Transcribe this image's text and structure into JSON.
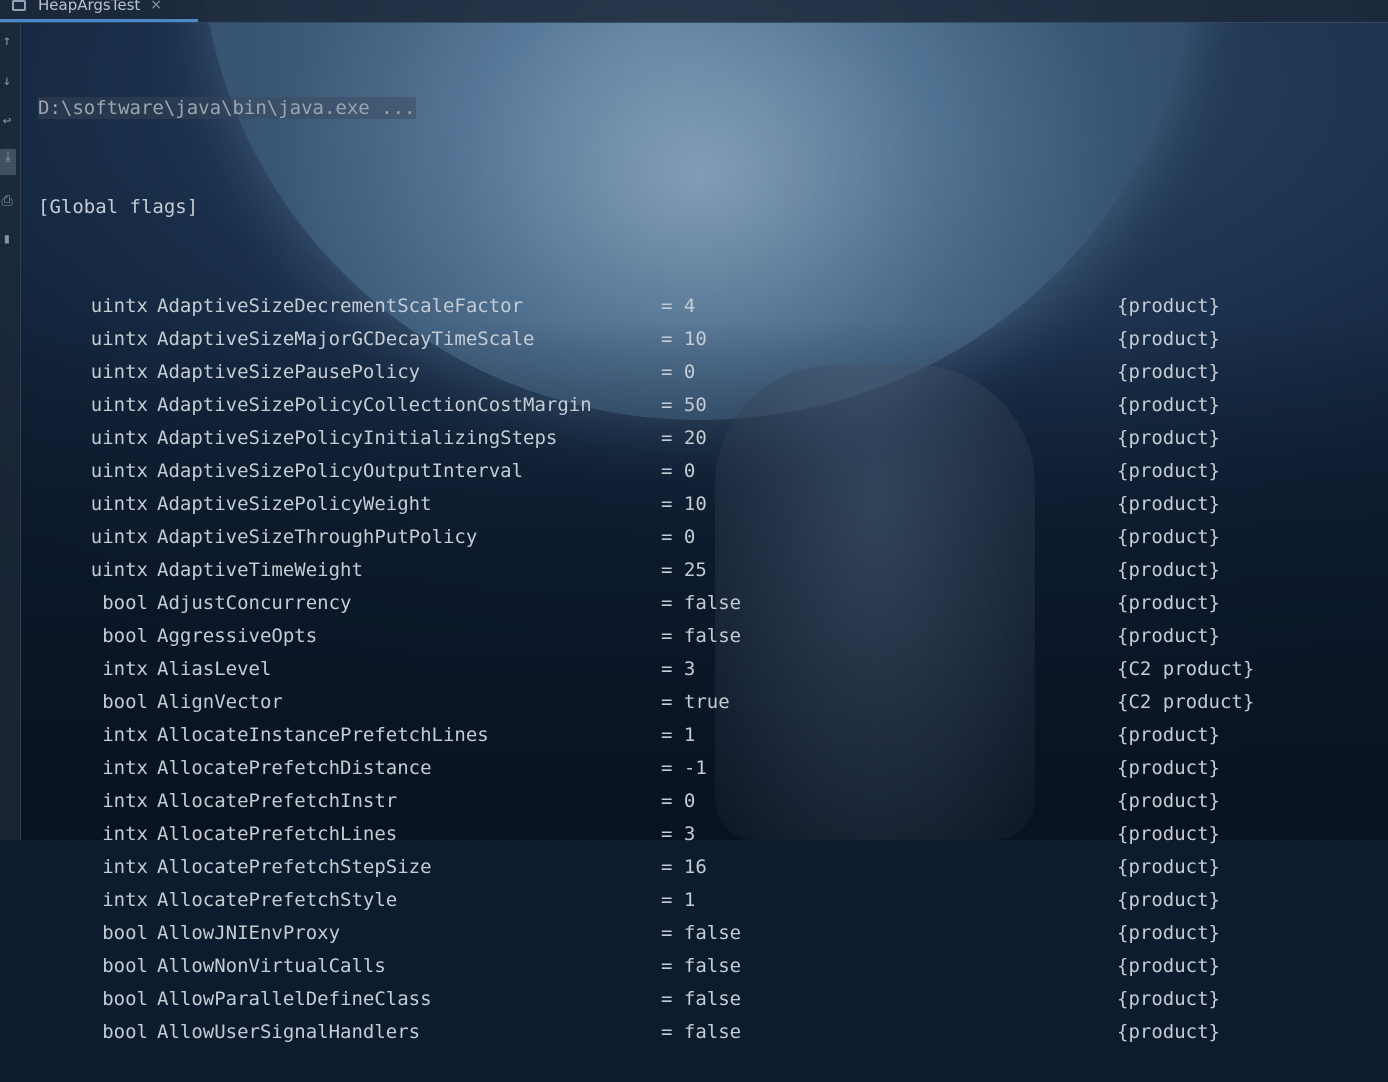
{
  "tab": {
    "title": "HeapArgsTest",
    "close_glyph": "×"
  },
  "gutter_icons": [
    "up-arrow-icon",
    "down-arrow-icon",
    "soft-wrap-icon",
    "scroll-to-end-icon",
    "print-icon",
    "trash-icon"
  ],
  "console": {
    "command": "D:\\software\\java\\bin\\java.exe ...",
    "section": "[Global flags]",
    "rows": [
      {
        "type": "uintx",
        "name": "AdaptiveSizeDecrementScaleFactor",
        "value": "= 4",
        "kind": "{product}"
      },
      {
        "type": "uintx",
        "name": "AdaptiveSizeMajorGCDecayTimeScale",
        "value": "= 10",
        "kind": "{product}"
      },
      {
        "type": "uintx",
        "name": "AdaptiveSizePausePolicy",
        "value": "= 0",
        "kind": "{product}"
      },
      {
        "type": "uintx",
        "name": "AdaptiveSizePolicyCollectionCostMargin",
        "value": "= 50",
        "kind": "{product}"
      },
      {
        "type": "uintx",
        "name": "AdaptiveSizePolicyInitializingSteps",
        "value": "= 20",
        "kind": "{product}"
      },
      {
        "type": "uintx",
        "name": "AdaptiveSizePolicyOutputInterval",
        "value": "= 0",
        "kind": "{product}"
      },
      {
        "type": "uintx",
        "name": "AdaptiveSizePolicyWeight",
        "value": "= 10",
        "kind": "{product}"
      },
      {
        "type": "uintx",
        "name": "AdaptiveSizeThroughPutPolicy",
        "value": "= 0",
        "kind": "{product}"
      },
      {
        "type": "uintx",
        "name": "AdaptiveTimeWeight",
        "value": "= 25",
        "kind": "{product}"
      },
      {
        "type": "bool",
        "name": "AdjustConcurrency",
        "value": "= false",
        "kind": "{product}"
      },
      {
        "type": "bool",
        "name": "AggressiveOpts",
        "value": "= false",
        "kind": "{product}"
      },
      {
        "type": "intx",
        "name": "AliasLevel",
        "value": "= 3",
        "kind": "{C2 product}"
      },
      {
        "type": "bool",
        "name": "AlignVector",
        "value": "= true",
        "kind": "{C2 product}"
      },
      {
        "type": "intx",
        "name": "AllocateInstancePrefetchLines",
        "value": "= 1",
        "kind": "{product}"
      },
      {
        "type": "intx",
        "name": "AllocatePrefetchDistance",
        "value": "= -1",
        "kind": "{product}"
      },
      {
        "type": "intx",
        "name": "AllocatePrefetchInstr",
        "value": "= 0",
        "kind": "{product}"
      },
      {
        "type": "intx",
        "name": "AllocatePrefetchLines",
        "value": "= 3",
        "kind": "{product}"
      },
      {
        "type": "intx",
        "name": "AllocatePrefetchStepSize",
        "value": "= 16",
        "kind": "{product}"
      },
      {
        "type": "intx",
        "name": "AllocatePrefetchStyle",
        "value": "= 1",
        "kind": "{product}"
      },
      {
        "type": "bool",
        "name": "AllowJNIEnvProxy",
        "value": "= false",
        "kind": "{product}"
      },
      {
        "type": "bool",
        "name": "AllowNonVirtualCalls",
        "value": "= false",
        "kind": "{product}"
      },
      {
        "type": "bool",
        "name": "AllowParallelDefineClass",
        "value": "= false",
        "kind": "{product}"
      },
      {
        "type": "bool",
        "name": "AllowUserSignalHandlers",
        "value": "= false",
        "kind": "{product}"
      }
    ]
  }
}
